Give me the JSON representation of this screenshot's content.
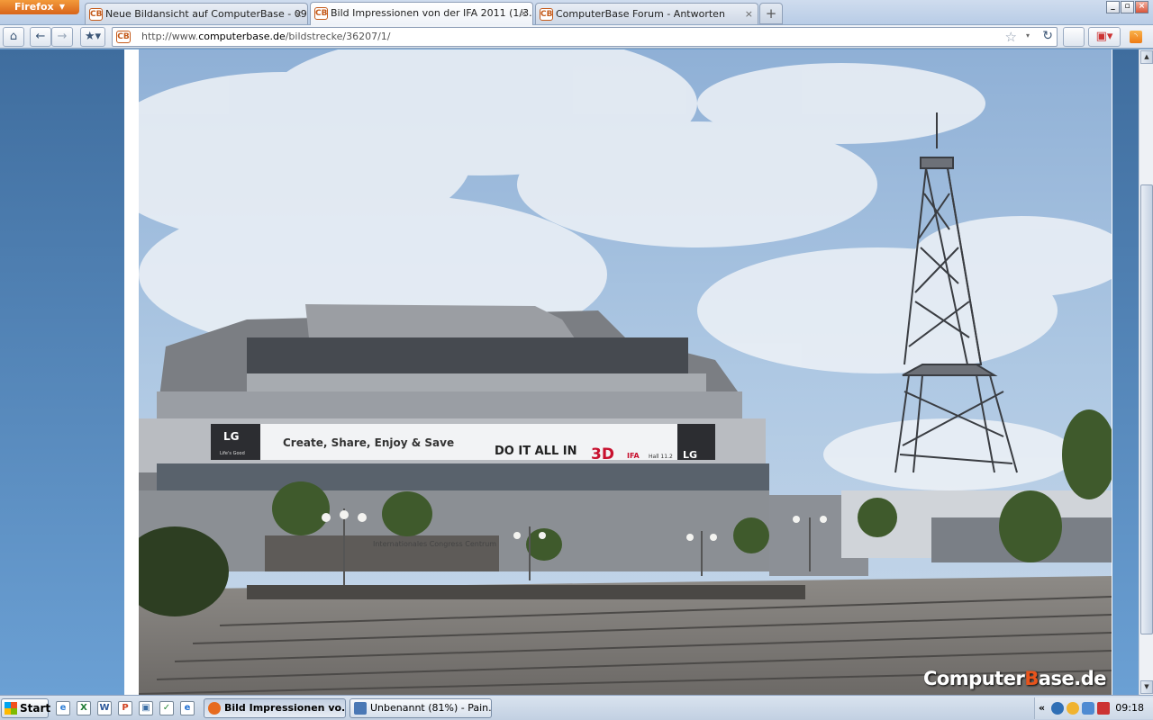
{
  "browser": {
    "menu_button": "Firefox",
    "tabs": [
      {
        "title": "Neue Bildansicht auf ComputerBase - 09....",
        "favicon": "CB"
      },
      {
        "title": "Bild Impressionen von der IFA 2011 (1/3...",
        "favicon": "CB"
      },
      {
        "title": "ComputerBase Forum - Antworten",
        "favicon": "CB"
      }
    ],
    "new_tab_glyph": "+",
    "close_glyph": "×",
    "window_controls": [
      "_",
      "▫",
      "×"
    ]
  },
  "nav": {
    "url_prefix": "http://www.",
    "url_domain": "computerbase.de",
    "url_path": "/bildstrecke/36207/1/",
    "favicon": "CB",
    "bookmark_icon": "star-icon"
  },
  "content": {
    "watermark_prefix": "Computer",
    "watermark_b": "B",
    "watermark_suffix": "ase.de",
    "banner_brand": "LG",
    "banner_text": "Create, Share, Enjoy & Save",
    "banner_text2": "DO IT ALL IN",
    "banner_3d": "3D",
    "banner_ifa": "IFA",
    "banner_hall": "Hall 11.2",
    "banner_tagline": "Life's Good",
    "building_sign": "Internationales Congress Centrum"
  },
  "taskbar": {
    "start_label": "Start",
    "quicklaunch": [
      {
        "name": "ie-icon",
        "glyph": "e",
        "color": "#2f7fd6"
      },
      {
        "name": "excel-icon",
        "glyph": "X",
        "color": "#1e7a34"
      },
      {
        "name": "word-icon",
        "glyph": "W",
        "color": "#2b579a"
      },
      {
        "name": "powerpoint-icon",
        "glyph": "P",
        "color": "#d04423"
      },
      {
        "name": "network-icon",
        "glyph": "▣",
        "color": "#3b6ea5"
      },
      {
        "name": "spreadsheet-icon",
        "glyph": "✓",
        "color": "#2a8a3a"
      },
      {
        "name": "ie-browser-icon",
        "glyph": "e",
        "color": "#1f6fd1"
      }
    ],
    "tasks": [
      {
        "label": "Bild Impressionen vo...",
        "active": true,
        "icon_color": "#e76b1f"
      },
      {
        "label": "Unbenannt (81%) - Pain...",
        "active": false,
        "icon_color": "#4a78b5"
      }
    ],
    "tray_expand": "«",
    "clock": "09:18"
  },
  "colors": {
    "firefox_orange": "#e27b29",
    "cb_orange": "#e8541c",
    "desktop_blue": "#6fa0cf"
  }
}
